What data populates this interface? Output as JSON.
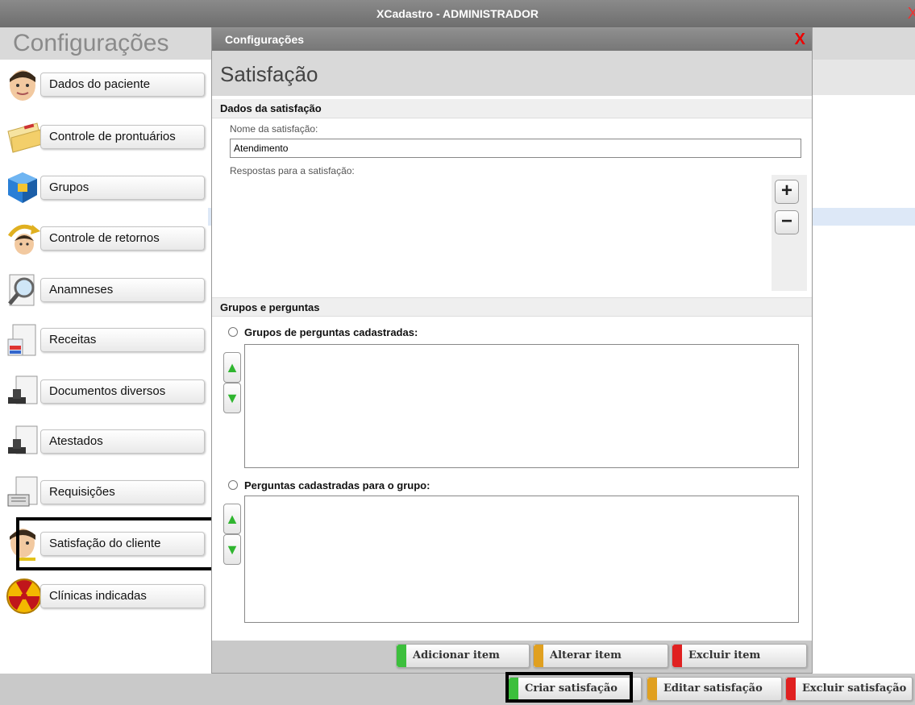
{
  "window": {
    "title": "XCadastro - ADMINISTRADOR",
    "close_glyph": "X"
  },
  "left_panel": {
    "heading": "Configurações"
  },
  "sidebar": {
    "items": [
      {
        "label": "Dados do paciente",
        "icon": "patient-face-icon"
      },
      {
        "label": "Controle de prontuários",
        "icon": "folder-icon"
      },
      {
        "label": "Grupos",
        "icon": "cube-icon"
      },
      {
        "label": "Controle de retornos",
        "icon": "return-icon"
      },
      {
        "label": "Anamneses",
        "icon": "magnifier-document-icon"
      },
      {
        "label": "Receitas",
        "icon": "prescription-icon"
      },
      {
        "label": "Documentos diversos",
        "icon": "stamp-document-icon"
      },
      {
        "label": "Atestados",
        "icon": "stamp-document-icon"
      },
      {
        "label": "Requisições",
        "icon": "requisition-icon"
      },
      {
        "label": "Satisfação do cliente",
        "icon": "satisfaction-face-icon"
      },
      {
        "label": "Clínicas indicadas",
        "icon": "radiation-icon"
      }
    ]
  },
  "dialog": {
    "title": "Configurações",
    "close_glyph": "X",
    "heading": "Satisfação",
    "section1": {
      "title": "Dados da satisfação",
      "name_label": "Nome da satisfação:",
      "name_value": "Atendimento",
      "answers_label": "Respostas para a satisfação:",
      "add_glyph": "+",
      "remove_glyph": "−"
    },
    "section2": {
      "title": "Grupos e perguntas",
      "groups_label": "Grupos de perguntas cadastradas:",
      "questions_label": "Perguntas cadastradas para o grupo:",
      "up_glyph": "▲",
      "down_glyph": "▼"
    },
    "footer_buttons": [
      {
        "label": "Adicionar item",
        "color": "#3cbf3c"
      },
      {
        "label": "Alterar item",
        "color": "#e0a020"
      },
      {
        "label": "Excluir item",
        "color": "#e02020"
      }
    ]
  },
  "bottom_buttons": [
    {
      "label": "Criar satisfação",
      "color": "#3cbf3c"
    },
    {
      "label": "Editar satisfação",
      "color": "#e0a020"
    },
    {
      "label": "Excluir satisfação",
      "color": "#e02020"
    }
  ]
}
